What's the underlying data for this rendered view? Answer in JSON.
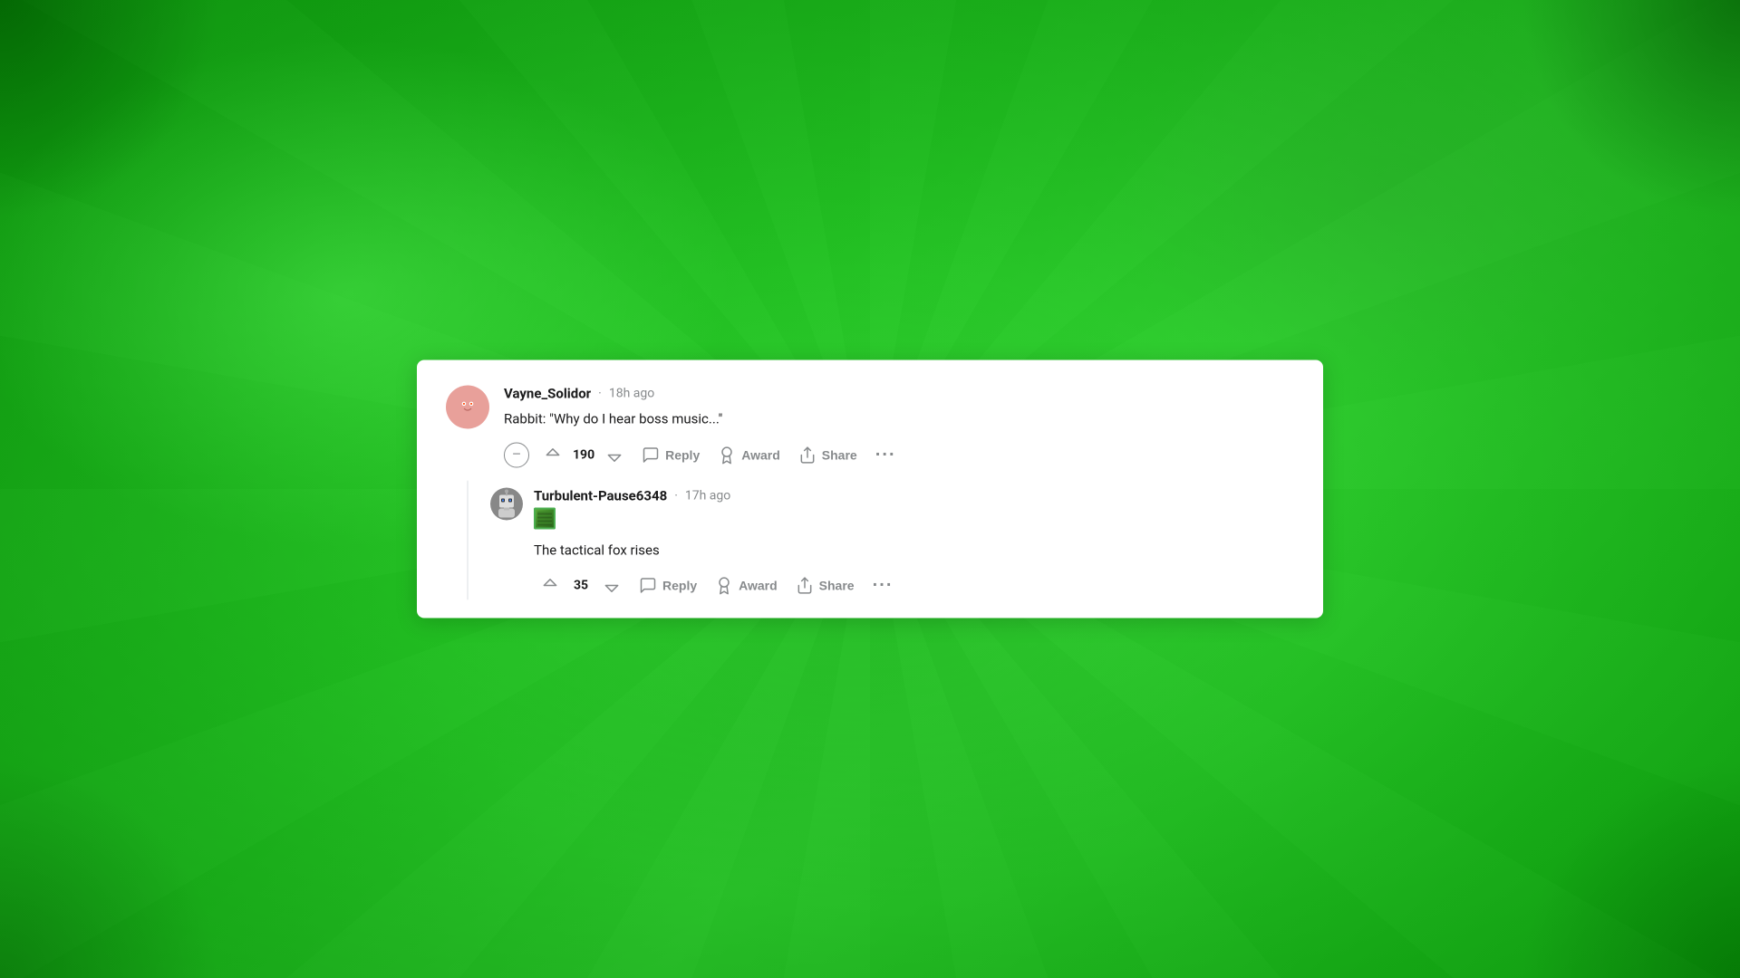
{
  "background": {
    "color": "#22cc22"
  },
  "card": {
    "comments": [
      {
        "id": "comment-1",
        "username": "Vayne_Solidor",
        "timestamp": "18h ago",
        "text": "Rabbit: \"Why do I hear boss music...\"",
        "vote_count": "190",
        "actions": {
          "reply": "Reply",
          "award": "Award",
          "share": "Share"
        },
        "replies": [
          {
            "id": "reply-1",
            "username": "Turbulent-Pause6348",
            "timestamp": "17h ago",
            "has_badge": true,
            "text": "The tactical fox rises",
            "vote_count": "35",
            "actions": {
              "reply": "Reply",
              "award": "Award",
              "share": "Share"
            }
          }
        ]
      }
    ]
  }
}
